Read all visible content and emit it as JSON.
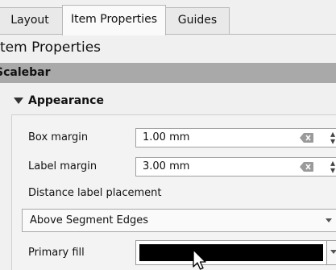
{
  "tabs": [
    {
      "label": "Layout",
      "active": false
    },
    {
      "label": "Item Properties",
      "active": true
    },
    {
      "label": "Guides",
      "active": false
    }
  ],
  "panel": {
    "title": "Item Properties"
  },
  "section": {
    "title": "Scalebar"
  },
  "group": {
    "title": "Appearance",
    "expanded": true
  },
  "fields": {
    "box_margin": {
      "label": "Box margin",
      "value": "1.00 mm"
    },
    "label_margin": {
      "label": "Label margin",
      "value": "3.00 mm"
    },
    "distance_label_placement": {
      "label": "Distance label placement",
      "selected": "Above Segment Edges"
    },
    "primary_fill": {
      "label": "Primary fill",
      "color": "#000000"
    }
  },
  "icons": {
    "clear": "clear-text-icon",
    "spin": "spin-arrows-icon",
    "dropdown": "chevron-down-icon",
    "cursor": "mouse-pointer-icon"
  }
}
